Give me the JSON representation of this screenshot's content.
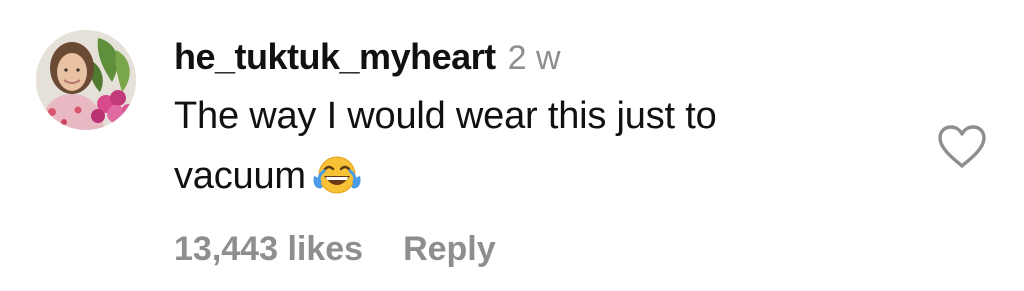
{
  "comment": {
    "username": "he_tuktuk_myheart",
    "time_ago": "2 w",
    "text_line1": "The way I would wear this just to",
    "text_line2": "vacuum",
    "emoji": "face-with-tears-of-joy",
    "likes_label": "13,443 likes",
    "reply_label": "Reply",
    "like_icon": "heart-outline-icon",
    "colors": {
      "text": "#111111",
      "secondary": "#8e8e8e"
    }
  }
}
